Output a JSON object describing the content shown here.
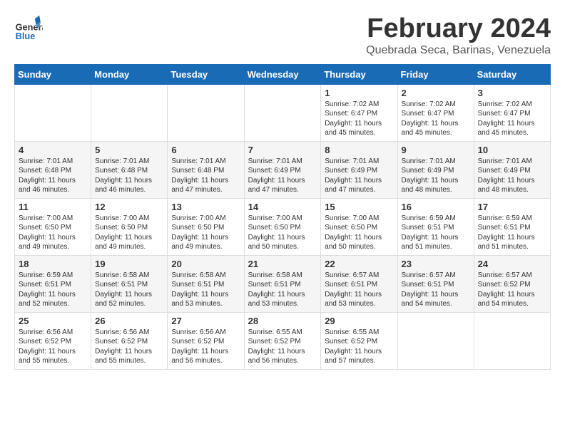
{
  "header": {
    "logo_general": "General",
    "logo_blue": "Blue",
    "month_title": "February 2024",
    "location": "Quebrada Seca, Barinas, Venezuela"
  },
  "weekdays": [
    "Sunday",
    "Monday",
    "Tuesday",
    "Wednesday",
    "Thursday",
    "Friday",
    "Saturday"
  ],
  "weeks": [
    [
      {
        "day": "",
        "info": ""
      },
      {
        "day": "",
        "info": ""
      },
      {
        "day": "",
        "info": ""
      },
      {
        "day": "",
        "info": ""
      },
      {
        "day": "1",
        "info": "Sunrise: 7:02 AM\nSunset: 6:47 PM\nDaylight: 11 hours\nand 45 minutes."
      },
      {
        "day": "2",
        "info": "Sunrise: 7:02 AM\nSunset: 6:47 PM\nDaylight: 11 hours\nand 45 minutes."
      },
      {
        "day": "3",
        "info": "Sunrise: 7:02 AM\nSunset: 6:47 PM\nDaylight: 11 hours\nand 45 minutes."
      }
    ],
    [
      {
        "day": "4",
        "info": "Sunrise: 7:01 AM\nSunset: 6:48 PM\nDaylight: 11 hours\nand 46 minutes."
      },
      {
        "day": "5",
        "info": "Sunrise: 7:01 AM\nSunset: 6:48 PM\nDaylight: 11 hours\nand 46 minutes."
      },
      {
        "day": "6",
        "info": "Sunrise: 7:01 AM\nSunset: 6:48 PM\nDaylight: 11 hours\nand 47 minutes."
      },
      {
        "day": "7",
        "info": "Sunrise: 7:01 AM\nSunset: 6:49 PM\nDaylight: 11 hours\nand 47 minutes."
      },
      {
        "day": "8",
        "info": "Sunrise: 7:01 AM\nSunset: 6:49 PM\nDaylight: 11 hours\nand 47 minutes."
      },
      {
        "day": "9",
        "info": "Sunrise: 7:01 AM\nSunset: 6:49 PM\nDaylight: 11 hours\nand 48 minutes."
      },
      {
        "day": "10",
        "info": "Sunrise: 7:01 AM\nSunset: 6:49 PM\nDaylight: 11 hours\nand 48 minutes."
      }
    ],
    [
      {
        "day": "11",
        "info": "Sunrise: 7:00 AM\nSunset: 6:50 PM\nDaylight: 11 hours\nand 49 minutes."
      },
      {
        "day": "12",
        "info": "Sunrise: 7:00 AM\nSunset: 6:50 PM\nDaylight: 11 hours\nand 49 minutes."
      },
      {
        "day": "13",
        "info": "Sunrise: 7:00 AM\nSunset: 6:50 PM\nDaylight: 11 hours\nand 49 minutes."
      },
      {
        "day": "14",
        "info": "Sunrise: 7:00 AM\nSunset: 6:50 PM\nDaylight: 11 hours\nand 50 minutes."
      },
      {
        "day": "15",
        "info": "Sunrise: 7:00 AM\nSunset: 6:50 PM\nDaylight: 11 hours\nand 50 minutes."
      },
      {
        "day": "16",
        "info": "Sunrise: 6:59 AM\nSunset: 6:51 PM\nDaylight: 11 hours\nand 51 minutes."
      },
      {
        "day": "17",
        "info": "Sunrise: 6:59 AM\nSunset: 6:51 PM\nDaylight: 11 hours\nand 51 minutes."
      }
    ],
    [
      {
        "day": "18",
        "info": "Sunrise: 6:59 AM\nSunset: 6:51 PM\nDaylight: 11 hours\nand 52 minutes."
      },
      {
        "day": "19",
        "info": "Sunrise: 6:58 AM\nSunset: 6:51 PM\nDaylight: 11 hours\nand 52 minutes."
      },
      {
        "day": "20",
        "info": "Sunrise: 6:58 AM\nSunset: 6:51 PM\nDaylight: 11 hours\nand 53 minutes."
      },
      {
        "day": "21",
        "info": "Sunrise: 6:58 AM\nSunset: 6:51 PM\nDaylight: 11 hours\nand 53 minutes."
      },
      {
        "day": "22",
        "info": "Sunrise: 6:57 AM\nSunset: 6:51 PM\nDaylight: 11 hours\nand 53 minutes."
      },
      {
        "day": "23",
        "info": "Sunrise: 6:57 AM\nSunset: 6:51 PM\nDaylight: 11 hours\nand 54 minutes."
      },
      {
        "day": "24",
        "info": "Sunrise: 6:57 AM\nSunset: 6:52 PM\nDaylight: 11 hours\nand 54 minutes."
      }
    ],
    [
      {
        "day": "25",
        "info": "Sunrise: 6:56 AM\nSunset: 6:52 PM\nDaylight: 11 hours\nand 55 minutes."
      },
      {
        "day": "26",
        "info": "Sunrise: 6:56 AM\nSunset: 6:52 PM\nDaylight: 11 hours\nand 55 minutes."
      },
      {
        "day": "27",
        "info": "Sunrise: 6:56 AM\nSunset: 6:52 PM\nDaylight: 11 hours\nand 56 minutes."
      },
      {
        "day": "28",
        "info": "Sunrise: 6:55 AM\nSunset: 6:52 PM\nDaylight: 11 hours\nand 56 minutes."
      },
      {
        "day": "29",
        "info": "Sunrise: 6:55 AM\nSunset: 6:52 PM\nDaylight: 11 hours\nand 57 minutes."
      },
      {
        "day": "",
        "info": ""
      },
      {
        "day": "",
        "info": ""
      }
    ]
  ]
}
